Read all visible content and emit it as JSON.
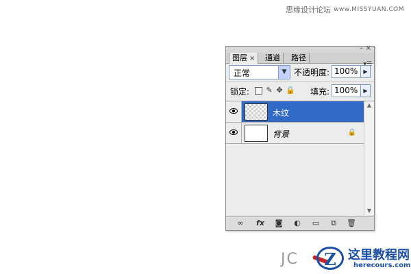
{
  "watermark_top": {
    "text": "思缘设计论坛",
    "url": "www.MISSYUAN.COM"
  },
  "panel": {
    "title_min": "–",
    "title_close": "×",
    "menu_icon": "panel-menu-icon",
    "tabs": [
      {
        "label": "图层",
        "close": "×"
      },
      {
        "label": "通道"
      },
      {
        "label": "路径"
      }
    ],
    "blend_mode": "正常",
    "opacity_label": "不透明度:",
    "opacity_value": "100%",
    "lock_label": "锁定:",
    "fill_label": "填充:",
    "fill_value": "100%",
    "layers": [
      {
        "name": "木纹",
        "selected": true
      },
      {
        "name": "背景",
        "selected": false,
        "locked": true
      }
    ],
    "bottom_icons": [
      "link-layers-icon",
      "fx-icon",
      "mask-icon",
      "adjustment-icon",
      "group-icon",
      "new-layer-icon",
      "trash-icon"
    ]
  },
  "watermark_bottom": {
    "jc": "JC",
    "logo_letter": "Z",
    "site_name": "这里教程网",
    "site_domain": "herecours.com"
  }
}
